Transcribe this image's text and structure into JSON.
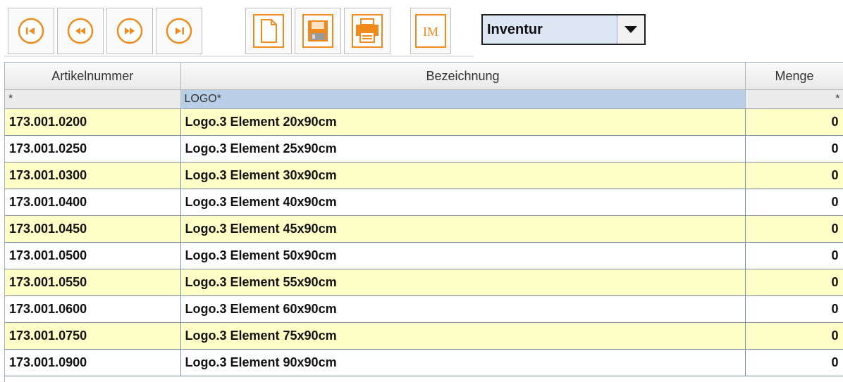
{
  "toolbar": {
    "buttons": [
      {
        "name": "first-record",
        "icon": "skip-to-first-icon"
      },
      {
        "name": "previous-record",
        "icon": "rewind-icon"
      },
      {
        "name": "next-record",
        "icon": "fast-forward-icon"
      },
      {
        "name": "last-record",
        "icon": "skip-to-last-icon"
      },
      {
        "name": "new-document",
        "icon": "new-document-icon"
      },
      {
        "name": "save",
        "icon": "floppy-disk-icon"
      },
      {
        "name": "print",
        "icon": "printer-icon"
      },
      {
        "name": "im",
        "icon": "im-icon",
        "label": "IM"
      }
    ],
    "mode_select": {
      "value": "Inventur"
    }
  },
  "table": {
    "columns": [
      "Artikelnummer",
      "Bezeichnung",
      "Menge"
    ],
    "filter": [
      "*",
      "LOGO*",
      "*"
    ],
    "rows": [
      {
        "artikelnummer": "173.001.0200",
        "bezeichnung": "Logo.3 Element 20x90cm",
        "menge": "0"
      },
      {
        "artikelnummer": "173.001.0250",
        "bezeichnung": "Logo.3 Element 25x90cm",
        "menge": "0"
      },
      {
        "artikelnummer": "173.001.0300",
        "bezeichnung": "Logo.3 Element 30x90cm",
        "menge": "0"
      },
      {
        "artikelnummer": "173.001.0400",
        "bezeichnung": "Logo.3 Element 40x90cm",
        "menge": "0"
      },
      {
        "artikelnummer": "173.001.0450",
        "bezeichnung": "Logo.3 Element 45x90cm",
        "menge": "0"
      },
      {
        "artikelnummer": "173.001.0500",
        "bezeichnung": "Logo.3 Element 50x90cm",
        "menge": "0"
      },
      {
        "artikelnummer": "173.001.0550",
        "bezeichnung": "Logo.3 Element 55x90cm",
        "menge": "0"
      },
      {
        "artikelnummer": "173.001.0600",
        "bezeichnung": "Logo.3 Element 60x90cm",
        "menge": "0"
      },
      {
        "artikelnummer": "173.001.0750",
        "bezeichnung": "Logo.3 Element 75x90cm",
        "menge": "0"
      },
      {
        "artikelnummer": "173.001.0900",
        "bezeichnung": "Logo.3 Element 90x90cm",
        "menge": "0"
      }
    ]
  },
  "colors": {
    "accent_orange": "#f08a1c",
    "row_alt": "#ffffc8",
    "filter_selected": "#b9cfe7",
    "combo_bg": "#dde6f3"
  }
}
